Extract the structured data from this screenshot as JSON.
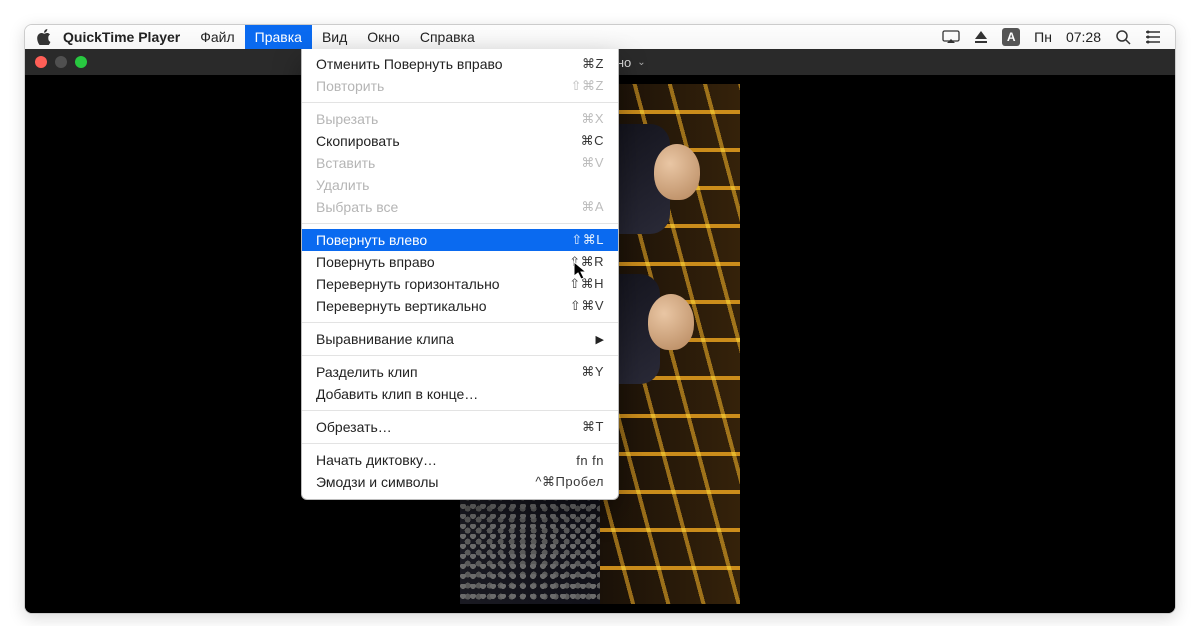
{
  "menubar": {
    "app": "QuickTime Player",
    "items": [
      "Файл",
      "Правка",
      "Вид",
      "Окно",
      "Справка"
    ],
    "active_index": 1,
    "status": {
      "lang": "А",
      "day": "Пн",
      "time": "07:28"
    }
  },
  "window": {
    "title_suffix": "— Изменено"
  },
  "menu": {
    "groups": [
      [
        {
          "label": "Отменить Повернуть вправо",
          "shortcut": "⌘Z",
          "enabled": true
        },
        {
          "label": "Повторить",
          "shortcut": "⇧⌘Z",
          "enabled": false
        }
      ],
      [
        {
          "label": "Вырезать",
          "shortcut": "⌘X",
          "enabled": false
        },
        {
          "label": "Скопировать",
          "shortcut": "⌘C",
          "enabled": true
        },
        {
          "label": "Вставить",
          "shortcut": "⌘V",
          "enabled": false
        },
        {
          "label": "Удалить",
          "shortcut": "",
          "enabled": false
        },
        {
          "label": "Выбрать все",
          "shortcut": "⌘A",
          "enabled": false
        }
      ],
      [
        {
          "label": "Повернуть влево",
          "shortcut": "⇧⌘L",
          "enabled": true,
          "highlight": true
        },
        {
          "label": "Повернуть вправо",
          "shortcut": "⇧⌘R",
          "enabled": true
        },
        {
          "label": "Перевернуть горизонтально",
          "shortcut": "⇧⌘H",
          "enabled": true
        },
        {
          "label": "Перевернуть вертикально",
          "shortcut": "⇧⌘V",
          "enabled": true
        }
      ],
      [
        {
          "label": "Выравнивание клипа",
          "shortcut": "",
          "enabled": true,
          "submenu": true
        }
      ],
      [
        {
          "label": "Разделить клип",
          "shortcut": "⌘Y",
          "enabled": true
        },
        {
          "label": "Добавить клип в конце…",
          "shortcut": "",
          "enabled": true
        }
      ],
      [
        {
          "label": "Обрезать…",
          "shortcut": "⌘T",
          "enabled": true
        }
      ],
      [
        {
          "label": "Начать диктовку…",
          "shortcut": "fn fn",
          "enabled": true
        },
        {
          "label": "Эмодзи и символы",
          "shortcut": "^⌘Пробел",
          "enabled": true
        }
      ]
    ]
  }
}
